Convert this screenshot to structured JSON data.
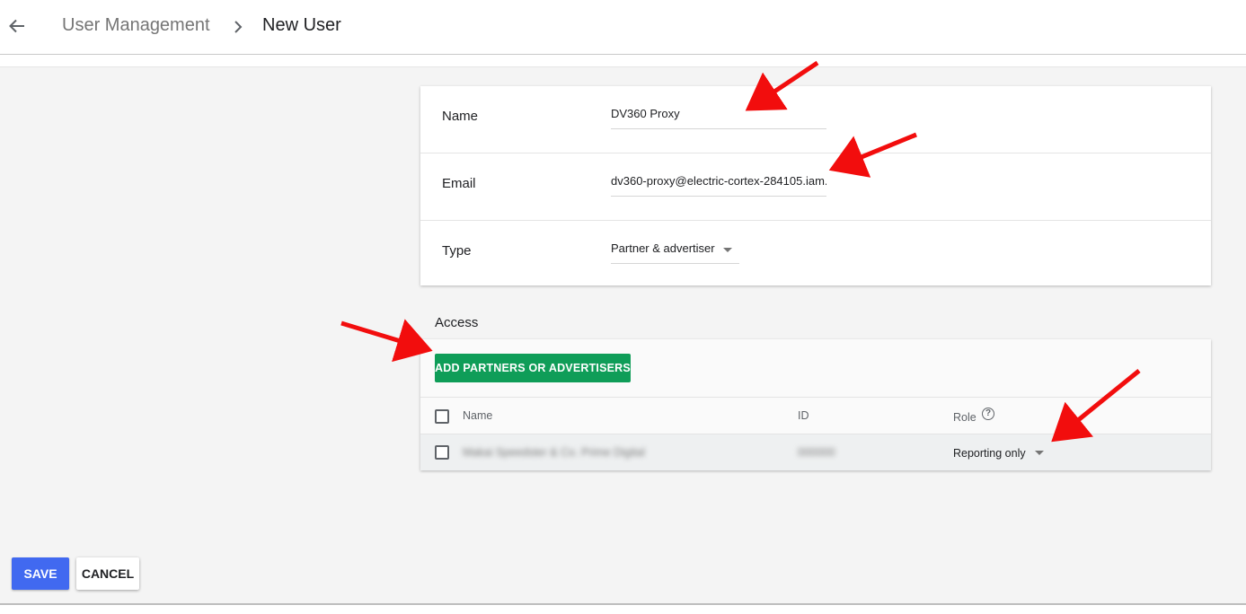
{
  "header": {
    "back_icon": "arrow-left-icon",
    "breadcrumb_parent": "User Management",
    "breadcrumb_separator_icon": "chevron-right-icon",
    "breadcrumb_current": "New User"
  },
  "form": {
    "name_label": "Name",
    "name_value": "DV360 Proxy",
    "email_label": "Email",
    "email_value": "dv360-proxy@electric-cortex-284105.iam.",
    "type_label": "Type",
    "type_value": "Partner & advertiser"
  },
  "access": {
    "title": "Access",
    "add_button_label": "ADD PARTNERS OR ADVERTISERS",
    "columns": {
      "name": "Name",
      "id": "ID",
      "role": "Role"
    },
    "rows": [
      {
        "name": "Makai Speedster & Co. Prime Digital",
        "id": "000000",
        "role": "Reporting only"
      }
    ]
  },
  "footer": {
    "save_label": "SAVE",
    "cancel_label": "CANCEL"
  },
  "colors": {
    "add_button": "#0f9d58",
    "save_button": "#4169f0",
    "annotation_arrow": "#f20d0d"
  }
}
